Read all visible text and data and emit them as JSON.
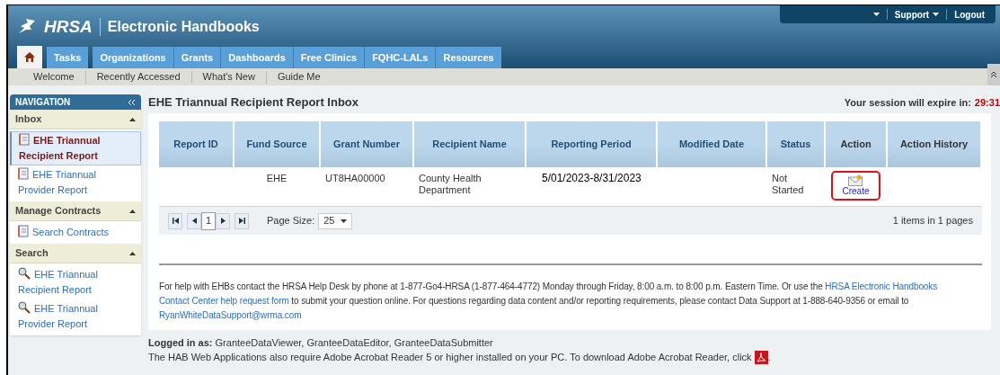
{
  "header": {
    "logo": "HRSA",
    "title": "Electronic Handbooks"
  },
  "user_menu": [
    {
      "kind": "dropdown"
    },
    {
      "kind": "dropdown",
      "label": "Support"
    },
    {
      "kind": "link",
      "label": "Logout"
    }
  ],
  "tabs": [
    {
      "kind": "home",
      "selected": true
    },
    {
      "kind": "tab",
      "label": "Tasks",
      "selected": false
    },
    {
      "kind": "tab",
      "label": "Organizations",
      "selected": false
    },
    {
      "kind": "tab",
      "label": "Grants",
      "selected": false
    },
    {
      "kind": "tab",
      "label": "Dashboards",
      "selected": false
    },
    {
      "kind": "tab",
      "label": "Free Clinics",
      "selected": false
    },
    {
      "kind": "tab",
      "label": "FQHC-LALs",
      "selected": false
    },
    {
      "kind": "tab",
      "label": "Resources",
      "selected": false
    }
  ],
  "subnav": [
    "Welcome",
    "Recently Accessed",
    "What's New",
    "Guide Me"
  ],
  "sidebar": {
    "title": "NAVIGATION",
    "sections": [
      {
        "title": "Inbox",
        "expanded": true,
        "items": [
          {
            "kind": "report",
            "label": "EHE Triannual Recipient Report",
            "selected": true
          },
          {
            "kind": "report",
            "label": "EHE Triannual Provider Report",
            "selected": false
          }
        ]
      },
      {
        "title": "Manage Contracts",
        "expanded": true,
        "items": [
          {
            "kind": "report",
            "label": "Search Contracts",
            "selected": false
          }
        ]
      },
      {
        "title": "Search",
        "expanded": true,
        "items": [
          {
            "kind": "search",
            "label": "EHE Triannual Recipient Report",
            "selected": false
          },
          {
            "kind": "search",
            "label": "EHE Triannual Provider Report",
            "selected": false
          }
        ]
      }
    ]
  },
  "page_title": "EHE Triannual Recipient Report Inbox",
  "session": {
    "label": "Your session will expire in:",
    "time": "29:31"
  },
  "table": {
    "columns": [
      "Report ID",
      "Fund Source",
      "Grant Number",
      "Recipient Name",
      "Reporting Period",
      "Modified Date",
      "Status",
      "Action",
      "Action History"
    ],
    "rows": [
      {
        "cells": [
          "",
          "EHE",
          "UT8HA00000",
          "County Health Department",
          "5/01/2023-8/31/2023",
          "",
          "Not Started"
        ],
        "action": "Create",
        "action_highlighted": true
      }
    ]
  },
  "pager": {
    "pages": [
      {
        "label": "1",
        "selected": true
      }
    ],
    "page_size_label": "Page Size:",
    "page_size": "25",
    "summary": "1 items in 1 pages"
  },
  "help_text": [
    {
      "kind": "text",
      "text": "For help with EHBs contact the HRSA Help Desk by phone at 1-877-Go4-HRSA (1-877-464-4772) Monday through Friday, 8:00 a.m. to 8:00 p.m. Eastern Time. Or use the "
    },
    {
      "kind": "link",
      "text": "HRSA Electronic Handbooks"
    },
    {
      "kind": "link",
      "text": "Contact Center help request form"
    },
    {
      "kind": "text",
      "text": " to submit your question online. For questions regarding data content and/or reporting requirements, please contact Data Support at 1-888-640-9356 or email to "
    },
    {
      "kind": "link",
      "text": "RyanWhiteDataSupport@wrma.com"
    }
  ],
  "footer": {
    "logged_in_label": "Logged in as:",
    "roles": "GranteeDataViewer, GranteeDataEditor, GranteeDataSubmitter",
    "adobe_text": "The HAB Web Applications also require Adobe Acrobat Reader 5 or higher installed on your PC. To download Adobe Acrobat Reader, click",
    "adobe_end": "."
  }
}
